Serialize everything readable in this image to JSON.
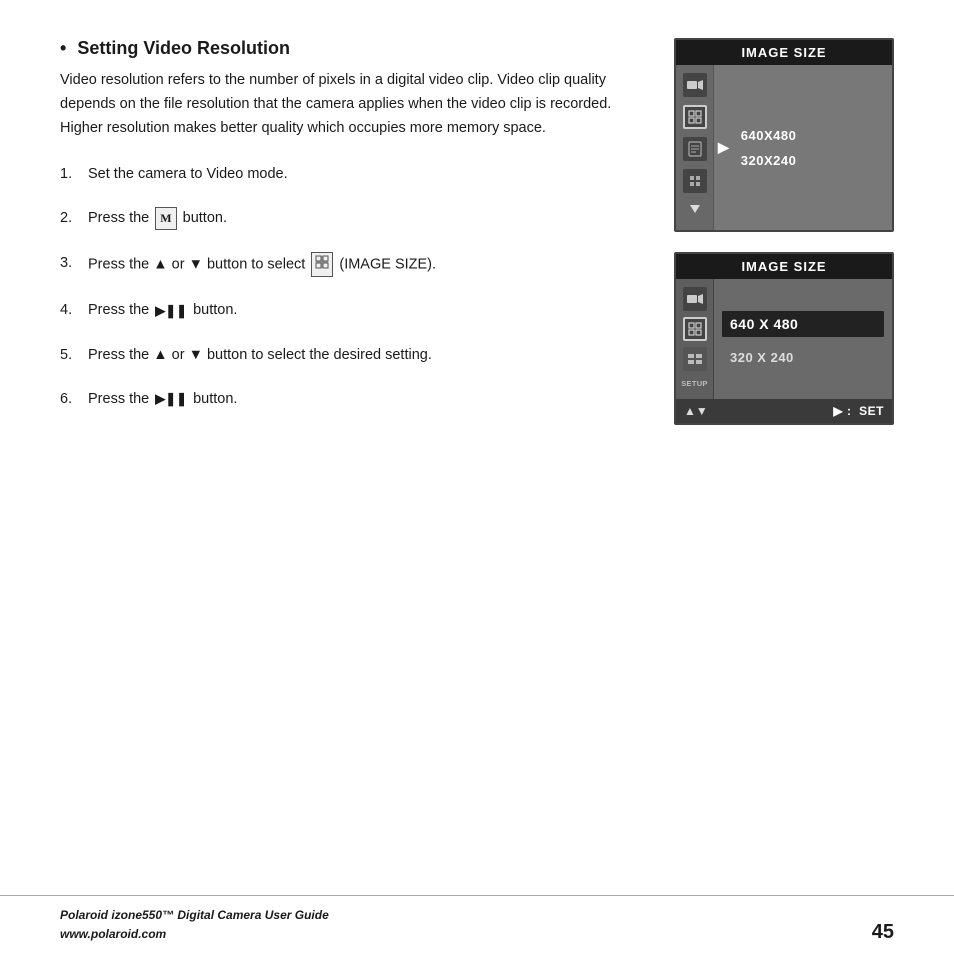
{
  "page": {
    "title": "Setting Video Resolution",
    "intro": "Video resolution refers to the number of pixels in a digital video clip. Video clip quality depends on the file resolution that the camera applies when the video clip is recorded. Higher resolution makes better quality which occupies more memory space.",
    "steps": [
      {
        "num": "1.",
        "text": "Set the camera to Video mode."
      },
      {
        "num": "2.",
        "text_before": "Press the ",
        "button_label": "M",
        "text_after": " button."
      },
      {
        "num": "3.",
        "text_before": "Press the ▲ or ▼ button to select ",
        "icon": "grid-icon",
        "text_after": " (IMAGE SIZE)."
      },
      {
        "num": "4.",
        "text_before": "Press the ",
        "icon": "play-pause",
        "text_after": " button."
      },
      {
        "num": "5.",
        "text_before": "Press the ▲ or ▼ button to select the desired setting."
      },
      {
        "num": "6.",
        "text_before": "Press the ",
        "icon": "play-pause",
        "text_after": " button."
      }
    ],
    "panel1": {
      "header": "IMAGE SIZE",
      "items": [
        "640X480",
        "320X240"
      ],
      "sidebar_icons": [
        "video",
        "grid",
        "film",
        "grid-small"
      ],
      "has_arrow": true
    },
    "panel2": {
      "header": "IMAGE SIZE",
      "items": [
        {
          "label": "640 X 480",
          "highlighted": true
        },
        {
          "label": "320 X 240",
          "highlighted": false
        }
      ],
      "sidebar_icons": [
        "video",
        "grid",
        "small-sq",
        "setup"
      ],
      "footer_arrow": "▲▼",
      "footer_set": "▶ :  SET"
    },
    "footer": {
      "brand": "Polaroid izone550™ Digital Camera User Guide",
      "url": "www.polaroid.com",
      "page_number": "45"
    }
  }
}
